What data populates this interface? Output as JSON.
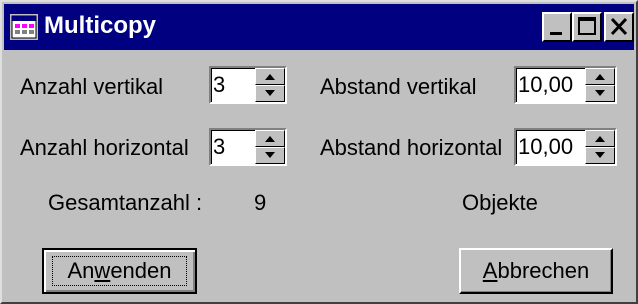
{
  "window": {
    "title": "Multicopy",
    "icon": "multicopy-app-icon",
    "controls": [
      "minimize-icon",
      "maximize-icon",
      "close-icon"
    ]
  },
  "fields": {
    "anzahl_vertikal": {
      "label": "Anzahl vertikal",
      "value": "3"
    },
    "anzahl_horizontal": {
      "label": "Anzahl horizontal",
      "value": "3"
    },
    "abstand_vertikal": {
      "label": "Abstand vertikal",
      "value": "10,00"
    },
    "abstand_horizontal": {
      "label": "Abstand horizontal",
      "value": "10,00"
    }
  },
  "summary": {
    "label": "Gesamtanzahl :",
    "count": "9",
    "unit": "Objekte"
  },
  "buttons": {
    "apply": {
      "label_pre": "An",
      "label_accel": "w",
      "label_post": "enden"
    },
    "cancel": {
      "label_pre": "",
      "label_accel": "A",
      "label_post": "bbrechen"
    }
  },
  "colors": {
    "titlebar": "#000080",
    "face": "#c0c0c0"
  }
}
